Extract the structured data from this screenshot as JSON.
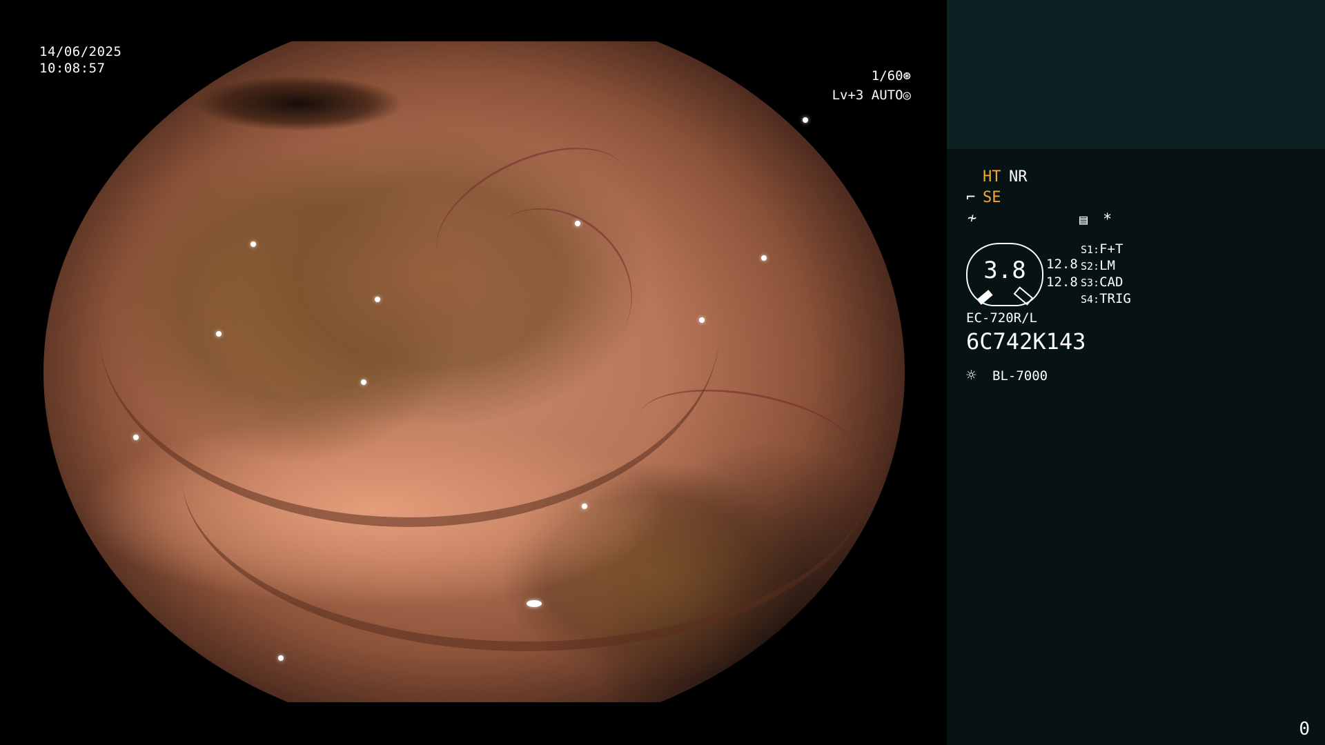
{
  "osd": {
    "date": "14/06/2025",
    "time": "10:08:57",
    "shutter": "1/60",
    "shutter_icon": "aperture-icon",
    "level": "Lv+3",
    "iris_mode": "AUTO",
    "iris_icon": "iris-icon"
  },
  "panel": {
    "ht": "HT",
    "nr": "NR",
    "se": "SE",
    "se_icon": "se-mode-icon",
    "slash_icon": "slash-icon",
    "menu_icon": "menu-icon",
    "star": "*",
    "gauge_value": "3.8",
    "gauge_side_1": "12.8",
    "gauge_side_2": "12.8",
    "scope_model": "EC-720R/L",
    "serial": "6C742K143",
    "light_source": "BL-7000",
    "light_icon": "sun-icon",
    "switches": [
      {
        "key": "S1:",
        "value": "F+T"
      },
      {
        "key": "S2:",
        "value": "LM"
      },
      {
        "key": "S3:",
        "value": "CAD"
      },
      {
        "key": "S4:",
        "value": "TRIG"
      }
    ],
    "counter": "0"
  },
  "colors": {
    "accent": "#f5a830",
    "panel_bg": "#071212",
    "panel_top_bg": "#0c2222"
  }
}
